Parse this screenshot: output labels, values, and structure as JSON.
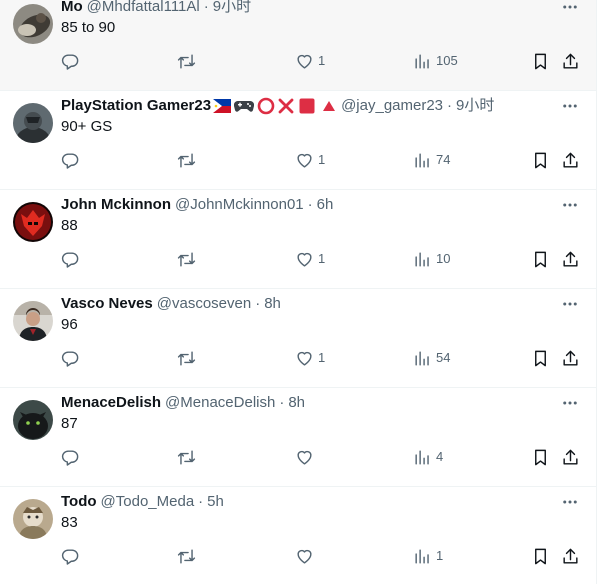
{
  "colors": {
    "text": "#0f1419",
    "secondary": "#536471",
    "divider": "#eff3f4",
    "hover_bg": "#f7f7f7"
  },
  "icons": {
    "reply": "reply-icon",
    "retweet": "retweet-icon",
    "like": "like-icon",
    "views": "views-icon",
    "bookmark": "bookmark-icon",
    "share": "share-icon",
    "more": "more-icon"
  },
  "tweets": [
    {
      "name": "Mo",
      "handle": "@Mhdfattal111Al",
      "sep": "·",
      "time": "9小时",
      "text": "85 to 90",
      "likes": "1",
      "views": "105"
    },
    {
      "name": "PlayStation Gamer23",
      "handle": "@jay_gamer23",
      "sep": "·",
      "time": "9小时",
      "text": "90+ GS",
      "likes": "1",
      "views": "74",
      "name_emoji": [
        "philippines-flag",
        "gamepad",
        "circle",
        "cross",
        "square",
        "triangle"
      ]
    },
    {
      "name": "John Mckinnon",
      "handle": "@JohnMckinnon01",
      "sep": "·",
      "time": "6h",
      "text": "88",
      "likes": "1",
      "views": "10"
    },
    {
      "name": "Vasco Neves",
      "handle": "@vascoseven",
      "sep": "·",
      "time": "8h",
      "text": "96",
      "likes": "1",
      "views": "54"
    },
    {
      "name": "MenaceDelish",
      "handle": "@MenaceDelish",
      "sep": "·",
      "time": "8h",
      "text": "87",
      "likes": "",
      "views": "4"
    },
    {
      "name": "Todo",
      "handle": "@Todo_Meda",
      "sep": "·",
      "time": "5h",
      "text": "83",
      "likes": "",
      "views": "1"
    }
  ]
}
